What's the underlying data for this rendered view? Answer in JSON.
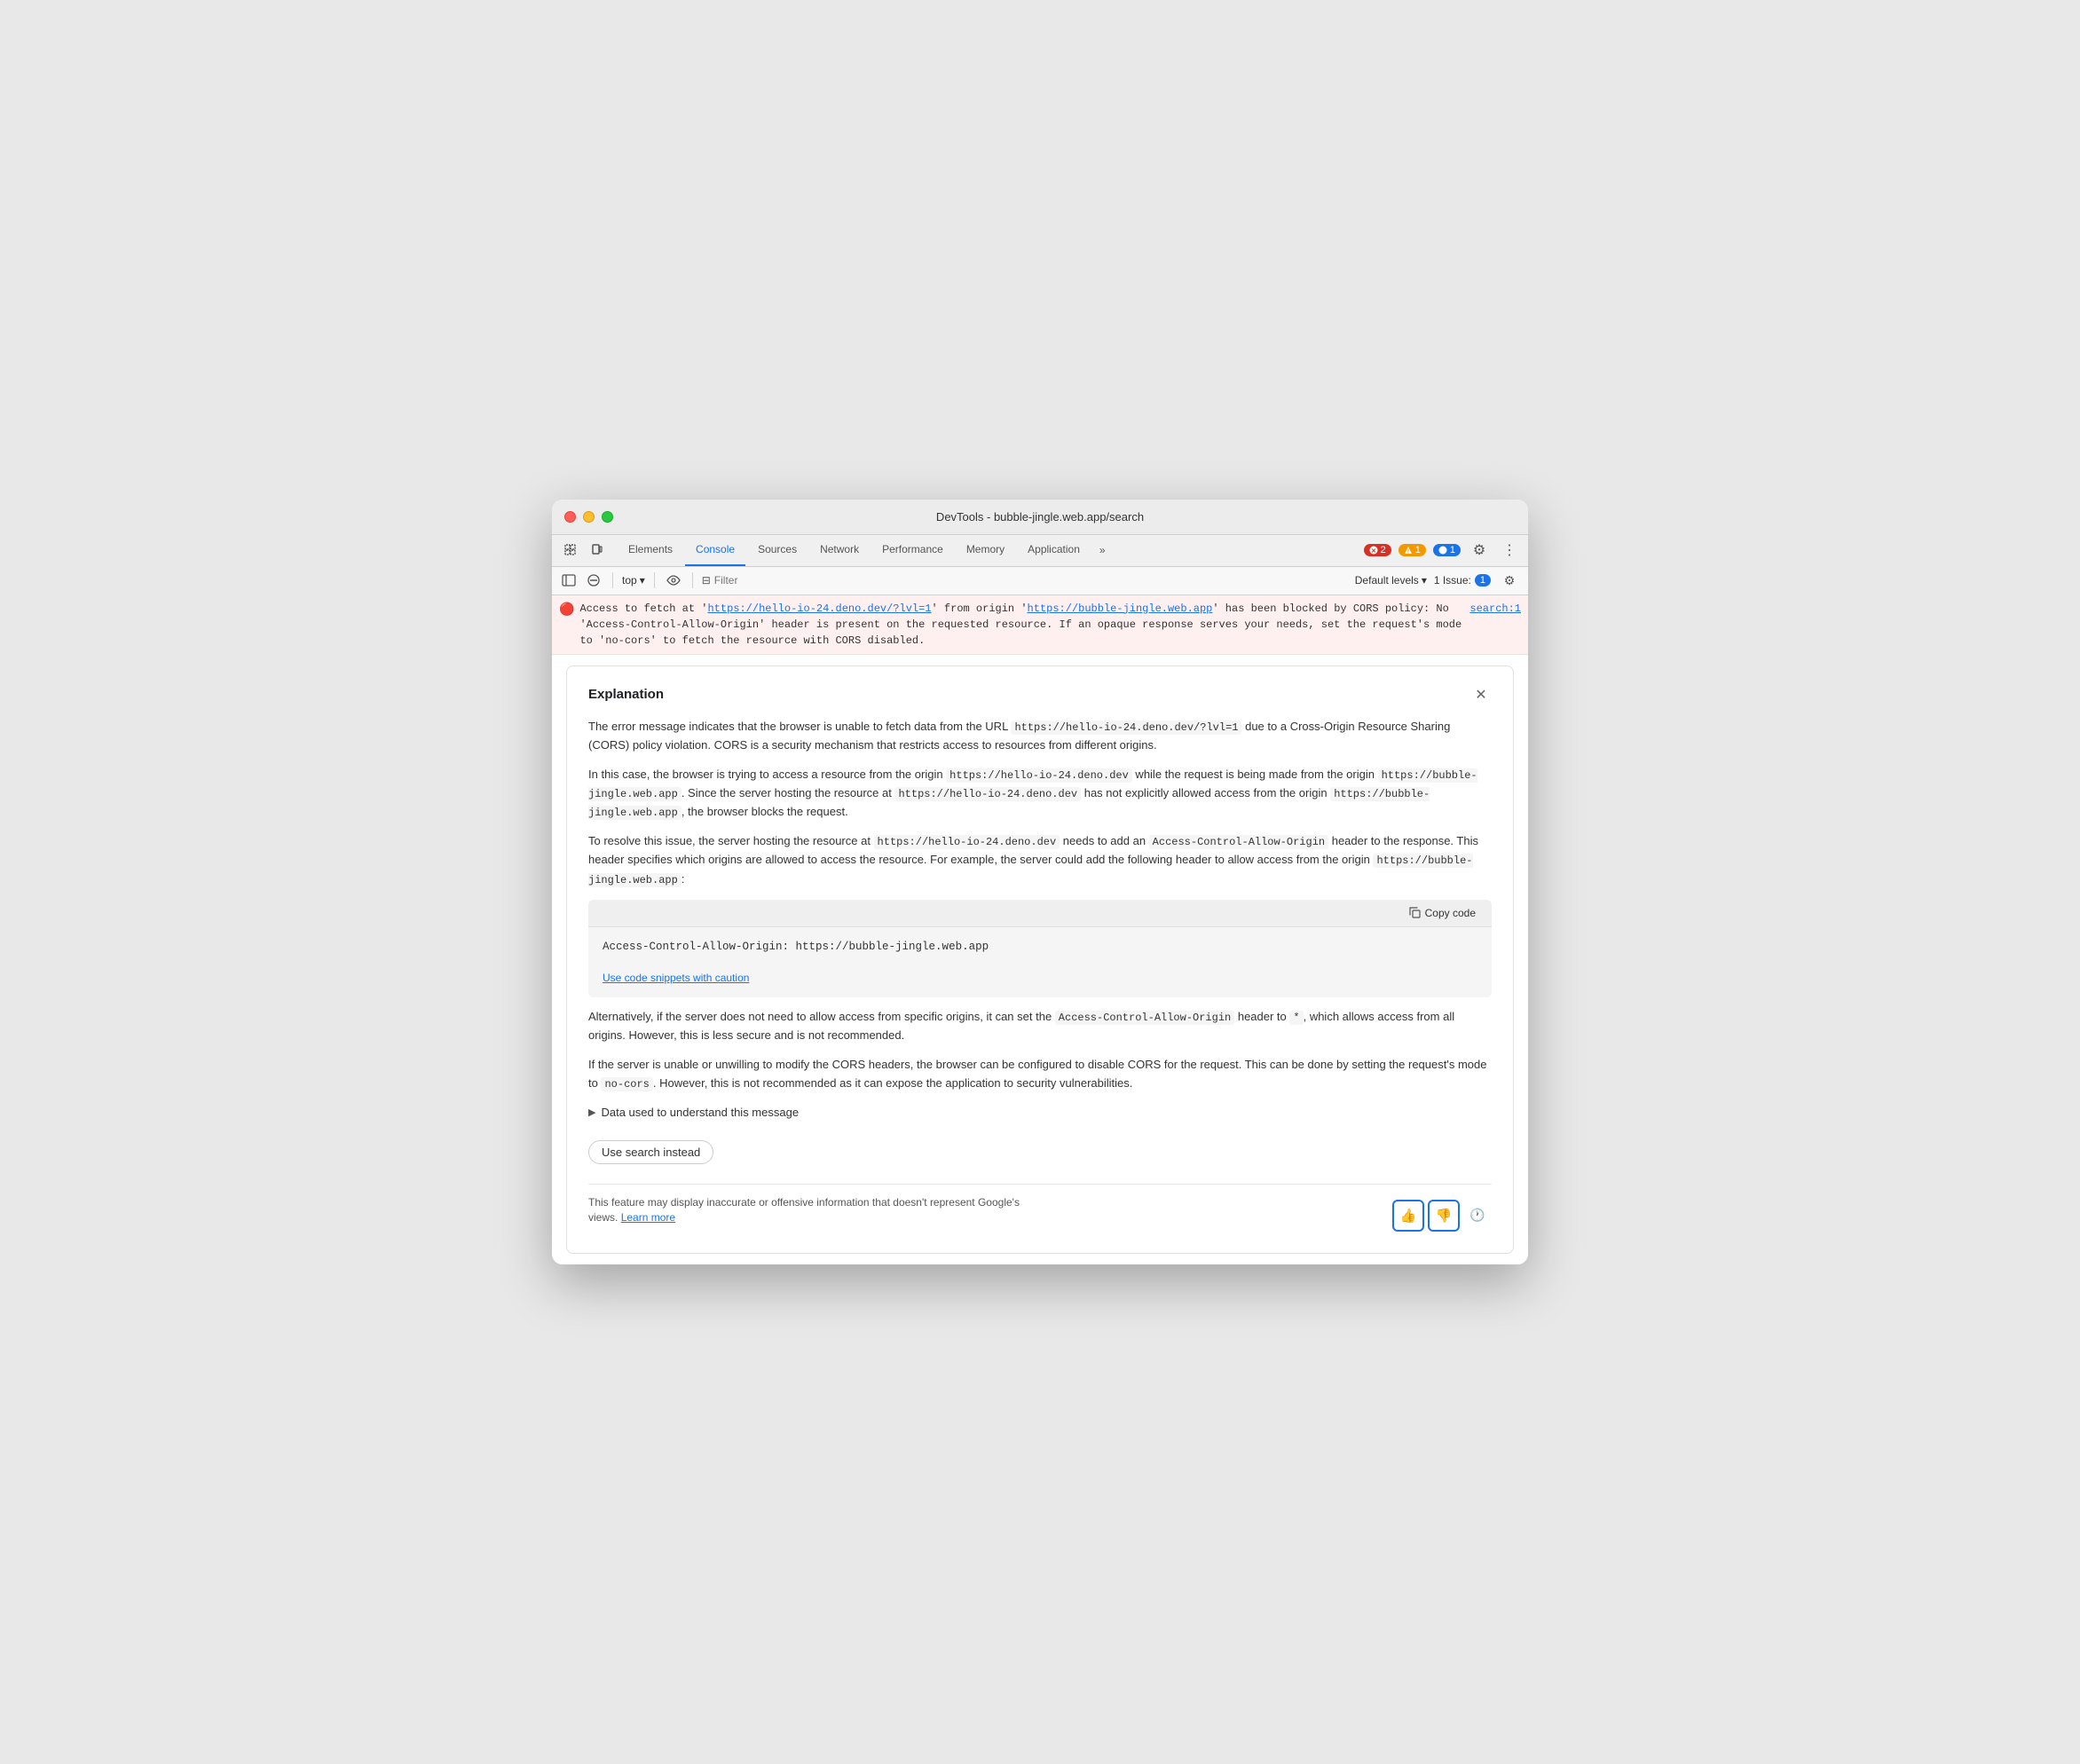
{
  "window": {
    "title": "DevTools - bubble-jingle.web.app/search"
  },
  "tabs": [
    {
      "id": "elements",
      "label": "Elements",
      "active": false
    },
    {
      "id": "console",
      "label": "Console",
      "active": true
    },
    {
      "id": "sources",
      "label": "Sources",
      "active": false
    },
    {
      "id": "network",
      "label": "Network",
      "active": false
    },
    {
      "id": "performance",
      "label": "Performance",
      "active": false
    },
    {
      "id": "memory",
      "label": "Memory",
      "active": false
    },
    {
      "id": "application",
      "label": "Application",
      "active": false
    }
  ],
  "badges": {
    "errors": "2",
    "warnings": "1",
    "info": "1"
  },
  "toolbar": {
    "context": "top",
    "filter_placeholder": "Filter",
    "levels": "Default levels",
    "issue_label": "1 Issue:",
    "issue_count": "1"
  },
  "error_message": {
    "prefix": "Access to fetch at '",
    "url1": "https://hello-io-24.deno.dev/?lvl=1",
    "mid1": "' from origin '",
    "url2": "https://bubble-jingle.web.app",
    "suffix": "' has been blocked by CORS policy: No 'Access-Control-Allow-Origin' header is present on the requested resource. If an opaque response serves your needs, set the request's mode to 'no-cors' to fetch the resource with CORS disabled.",
    "file_ref": "search:1"
  },
  "explanation": {
    "title": "Explanation",
    "body_p1": "The error message indicates that the browser is unable to fetch data from the URL https://hello-io-24.deno.dev/?lvl=1 due to a Cross-Origin Resource Sharing (CORS) policy violation. CORS is a security mechanism that restricts access to resources from different origins.",
    "body_p2_a": "In this case, the browser is trying to access a resource from the origin ",
    "body_p2_code1": "https://hello-io-24.deno.dev",
    "body_p2_b": " while the request is being made from the origin ",
    "body_p2_code2": "https://bubble-jingle.web.app",
    "body_p2_c": ". Since the server hosting the resource at ",
    "body_p2_code3": "https://hello-io-24.deno.dev",
    "body_p2_d": " has not explicitly allowed access from the origin ",
    "body_p2_code4": "https://bubble-jingle.web.app",
    "body_p2_e": ", the browser blocks the request.",
    "body_p3_a": "To resolve this issue, the server hosting the resource at ",
    "body_p3_code1": "https://hello-io-24.deno.dev",
    "body_p3_b": " needs to add an ",
    "body_p3_code2": "Access-Control-Allow-Origin",
    "body_p3_c": " header to the response. This header specifies which origins are allowed to access the resource. For example, the server could add the following header to allow access from the origin ",
    "body_p3_code3": "https://bubble-jingle.web.app",
    "body_p3_d": ":",
    "copy_code_label": "Copy code",
    "code_snippet": "Access-Control-Allow-Origin: https://bubble-jingle.web.app",
    "caution_link": "Use code snippets with caution",
    "body_p4_a": "Alternatively, if the server does not need to allow access from specific origins, it can set the ",
    "body_p4_code1": "Access-Control-Allow-Origin",
    "body_p4_b": " header to ",
    "body_p4_code2": "*",
    "body_p4_c": ", which allows access from all origins. However, this is less secure and is not recommended.",
    "body_p5_a": "If the server is unable or unwilling to modify the CORS headers, the browser can be configured to disable CORS for the request. This can be done by setting the request's mode to ",
    "body_p5_code1": "no-cors",
    "body_p5_b": ". However, this is not recommended as it can expose the application to security vulnerabilities.",
    "data_disclosure": "Data used to understand this message",
    "use_search_label": "Use search instead",
    "feedback_text": "This feature may display inaccurate or offensive information that doesn't represent Google's views.",
    "learn_more": "Learn more"
  }
}
